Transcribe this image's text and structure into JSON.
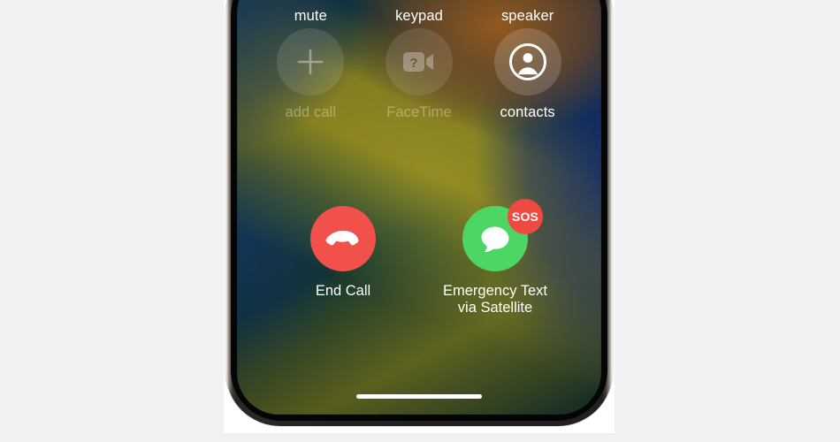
{
  "page": {
    "background_color": "#f1f1f1",
    "card_color": "#ffffff"
  },
  "device": {
    "name": "iphone",
    "frame_color": "#222020",
    "bezel_color": "#050505"
  },
  "screen": {
    "wallpaper_colors": [
      "#13424d",
      "#10313a",
      "#143c38",
      "#15362f",
      "#b06824",
      "#143078",
      "#c6b01c"
    ]
  },
  "call_actions": [
    {
      "id": "mute",
      "label": "mute",
      "icon": "microphone-slash-icon",
      "enabled": true,
      "row": 1
    },
    {
      "id": "keypad",
      "label": "keypad",
      "icon": "keypad-grid-icon",
      "enabled": true,
      "row": 1
    },
    {
      "id": "speaker",
      "label": "speaker",
      "icon": "speaker-wave-icon",
      "enabled": true,
      "row": 1
    },
    {
      "id": "add_call",
      "label": "add call",
      "icon": "plus-icon",
      "enabled": false,
      "row": 2
    },
    {
      "id": "facetime",
      "label": "FaceTime",
      "icon": "video-camera-icon",
      "enabled": false,
      "row": 2
    },
    {
      "id": "contacts",
      "label": "contacts",
      "icon": "person-circle-icon",
      "enabled": true,
      "row": 2
    }
  ],
  "call_controls": {
    "end_call": {
      "label": "End Call",
      "icon": "phone-down-icon",
      "color": "#f1514a"
    },
    "emergency_text": {
      "label": "Emergency Text\nvia Satellite",
      "icon": "messages-bubble-icon",
      "color": "#4cd663",
      "badge": {
        "text": "SOS",
        "color": "#ef4a42"
      }
    }
  },
  "home_indicator": {
    "name": "home-indicator",
    "color": "#ffffff"
  }
}
